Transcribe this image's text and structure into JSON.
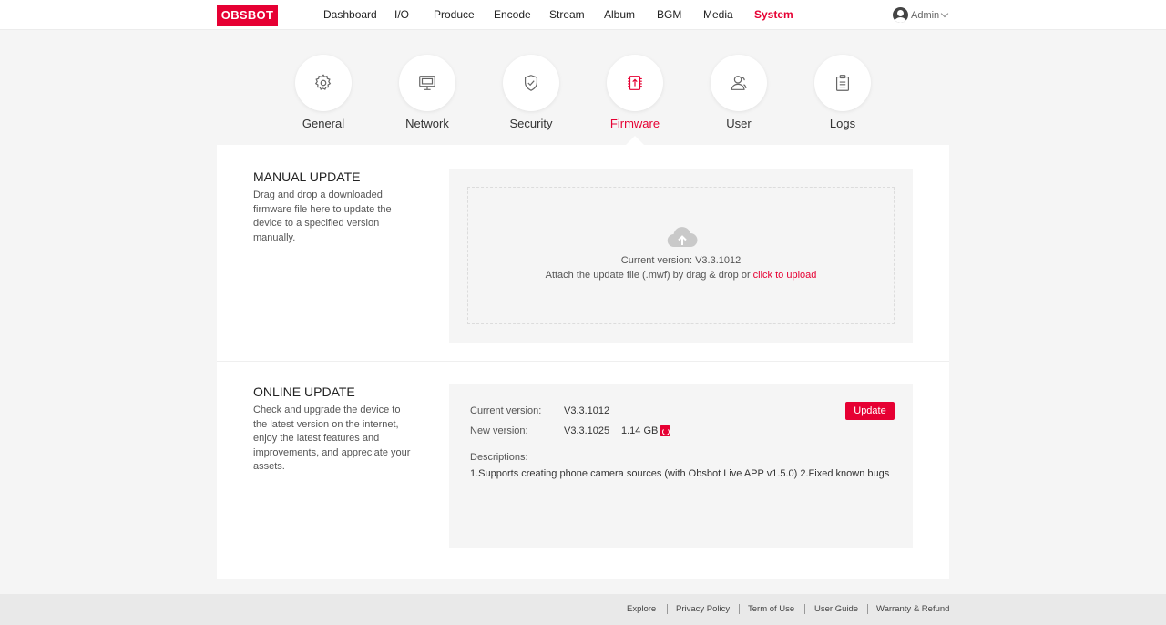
{
  "header": {
    "logo": "OBSBOT",
    "nav": [
      "Dashboard",
      "I/O",
      "Produce",
      "Encode",
      "Stream",
      "Album",
      "BGM",
      "Media",
      "System"
    ],
    "active_nav": "System",
    "user": "Admin"
  },
  "system_tabs": [
    {
      "label": "General",
      "icon": "gear-icon"
    },
    {
      "label": "Network",
      "icon": "monitor-icon"
    },
    {
      "label": "Security",
      "icon": "shield-icon"
    },
    {
      "label": "Firmware",
      "icon": "chip-icon"
    },
    {
      "label": "User",
      "icon": "user-icon"
    },
    {
      "label": "Logs",
      "icon": "clipboard-icon"
    }
  ],
  "active_tab": "Firmware",
  "manual_update": {
    "title": "MANUAL UPDATE",
    "description": "Drag and drop a downloaded firmware file here to update the device to a specified version manually.",
    "current_version_text": "Current version: V3.3.1012",
    "attach_text": "Attach the update file (.mwf) by drag & drop or ",
    "upload_link": "click to upload"
  },
  "online_update": {
    "title": "ONLINE UPDATE",
    "description": "Check and upgrade the device to the latest version on the internet, enjoy the latest features and improvements, and appreciate your assets.",
    "current_version_label": "Current version:",
    "current_version": "V3.3.1012",
    "new_version_label": "New version:",
    "new_version": "V3.3.1025",
    "new_size": "1.14 GB",
    "update_button": "Update",
    "descriptions_label": "Descriptions:",
    "descriptions": "1.Supports creating phone camera sources (with Obsbot Live APP v1.5.0) 2.Fixed known bugs"
  },
  "footer": [
    "Explore",
    "Privacy Policy",
    "Term of Use",
    "User Guide",
    "Warranty & Refund"
  ],
  "colors": {
    "accent": "#e60033",
    "background": "#f5f5f5"
  }
}
